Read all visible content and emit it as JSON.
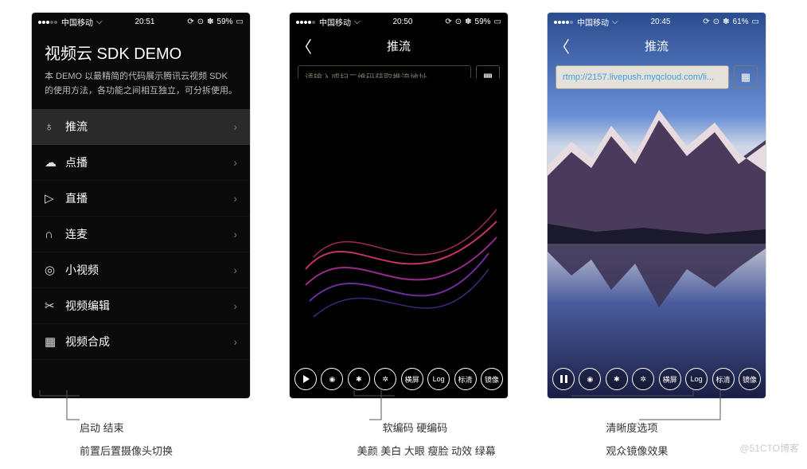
{
  "statusbar": {
    "carrier": "中国移动",
    "wifi": "⁠",
    "bt": "✽",
    "batt": "▮"
  },
  "phone1": {
    "time": "20:51",
    "batt_pct": "59%",
    "title": "视频云 SDK DEMO",
    "desc": "本 DEMO 以最精简的代码展示腾讯云视频 SDK 的使用方法，各功能之间相互独立，可分拆使用。",
    "menu": [
      {
        "icon": "♁",
        "label": "推流",
        "name": "menu-push"
      },
      {
        "icon": "☁",
        "label": "点播",
        "name": "menu-vod"
      },
      {
        "icon": "▷",
        "label": "直播",
        "name": "menu-live"
      },
      {
        "icon": "∩",
        "label": "连麦",
        "name": "menu-mic"
      },
      {
        "icon": "◎",
        "label": "小视频",
        "name": "menu-short"
      },
      {
        "icon": "✂",
        "label": "视频编辑",
        "name": "menu-edit"
      },
      {
        "icon": "▦",
        "label": "视频合成",
        "name": "menu-compose"
      }
    ]
  },
  "phone2": {
    "time": "20:50",
    "batt_pct": "59%",
    "nav_title": "推流",
    "placeholder": "请输入或扫二维码获取推流地址",
    "controls": [
      {
        "name": "play-btn",
        "kind": "play"
      },
      {
        "name": "camera-btn",
        "txt": "◉"
      },
      {
        "name": "flash-off-btn",
        "txt": "✱"
      },
      {
        "name": "flash-btn",
        "txt": "✲"
      },
      {
        "name": "orient-btn",
        "txt": "横屏"
      },
      {
        "name": "log-btn",
        "txt": "Log"
      },
      {
        "name": "hd-btn",
        "txt": "标清"
      },
      {
        "name": "mirror-btn",
        "txt": "镜像"
      }
    ]
  },
  "phone3": {
    "time": "20:45",
    "batt_pct": "61%",
    "nav_title": "推流",
    "url": "rtmp://2157.livepush.myqcloud.com/li...",
    "controls": [
      {
        "name": "pause-btn",
        "kind": "pause"
      },
      {
        "name": "camera-btn",
        "txt": "◉"
      },
      {
        "name": "flash-off-btn",
        "txt": "✱"
      },
      {
        "name": "flash-btn",
        "txt": "✲"
      },
      {
        "name": "orient-btn",
        "txt": "横屏"
      },
      {
        "name": "log-btn",
        "txt": "Log"
      },
      {
        "name": "hd-btn",
        "txt": "标清"
      },
      {
        "name": "mirror-btn",
        "txt": "镜像"
      }
    ]
  },
  "annot": {
    "col1_l1": "启动 结束",
    "col1_l2": "前置后置摄像头切换",
    "col2_l1": "软编码 硬编码",
    "col2_l2": "美颜 美白 大眼 瘦脸 动效 绿幕",
    "col3_l1": "清晰度选项",
    "col3_l2": "观众镜像效果"
  },
  "watermark": "@51CTO博客"
}
